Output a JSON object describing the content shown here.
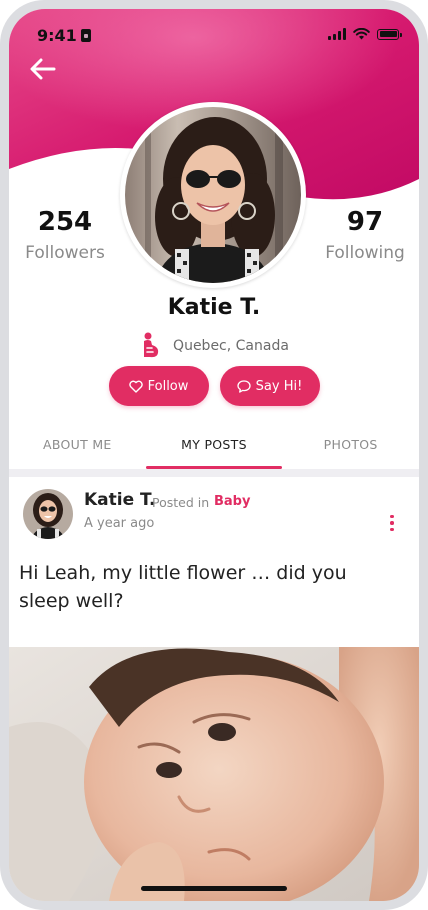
{
  "status_bar": {
    "time": "9:41"
  },
  "profile": {
    "name": "Katie T.",
    "location": "Quebec, Canada",
    "followers_count": "254",
    "followers_label": "Followers",
    "following_count": "97",
    "following_label": "Following"
  },
  "actions": {
    "follow_label": "Follow",
    "say_hi_label": "Say Hi!"
  },
  "tabs": [
    {
      "label": "ABOUT ME",
      "active": false
    },
    {
      "label": "MY POSTS",
      "active": true
    },
    {
      "label": "PHOTOS",
      "active": false
    }
  ],
  "post": {
    "author": "Katie T.",
    "posted_in_label": "Posted in",
    "category": "Baby",
    "time": "A year ago",
    "text": "Hi Leah, my little flower … did you sleep well?"
  },
  "colors": {
    "accent": "#e12d63",
    "header_gradient": [
      "#f2609a",
      "#d81a6e"
    ]
  },
  "icons": [
    "back-arrow-icon",
    "lock-icon",
    "signal-icon",
    "wifi-icon",
    "battery-icon",
    "pregnant-icon",
    "heart-icon",
    "chat-bubble-icon",
    "more-vertical-icon"
  ]
}
